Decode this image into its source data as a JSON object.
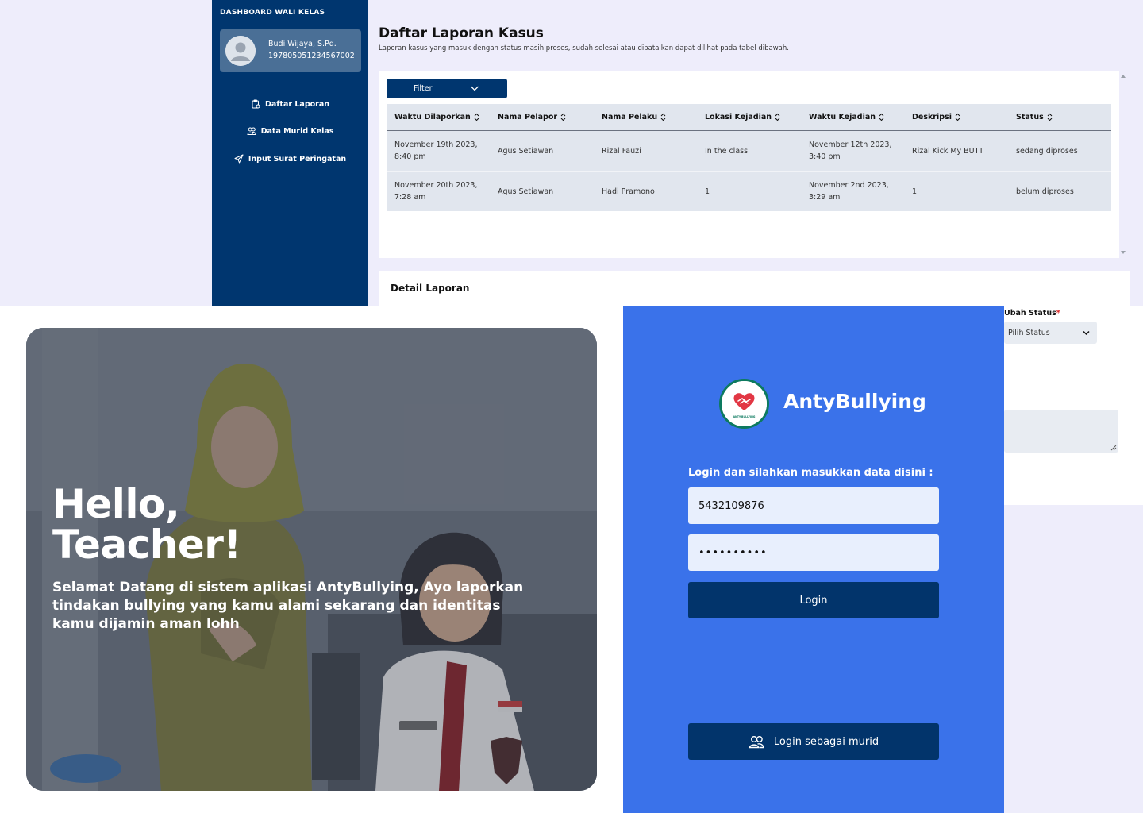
{
  "sidebar": {
    "title": "DASHBOARD WALI KELAS",
    "profile": {
      "name": "Budi Wijaya, S.Pd.",
      "nip": "197805051234567002"
    },
    "items": [
      {
        "label": "Daftar Laporan",
        "icon": "clipboard-icon"
      },
      {
        "label": "Data Murid Kelas",
        "icon": "users-icon"
      },
      {
        "label": "Input Surat Peringatan",
        "icon": "send-icon"
      }
    ]
  },
  "main": {
    "title": "Daftar Laporan Kasus",
    "subtitle": "Laporan kasus yang masuk dengan status masih proses, sudah selesai atau dibatalkan dapat dilihat pada tabel dibawah.",
    "filter_label": "Filter",
    "table": {
      "headers": [
        "Waktu Dilaporkan",
        "Nama Pelapor",
        "Nama Pelaku",
        "Lokasi Kejadian",
        "Waktu Kejadian",
        "Deskripsi",
        "Status"
      ],
      "rows": [
        {
          "reported_l1": "November 19th 2023,",
          "reported_l2": "8:40 pm",
          "reporter": "Agus Setiawan",
          "perpetrator": "Rizal Fauzi",
          "location": "In the class",
          "incident_l1": "November 12th 2023,",
          "incident_l2": "3:40 pm",
          "description": "Rizal Kick My BUTT",
          "status": "sedang diproses"
        },
        {
          "reported_l1": "November 20th 2023,",
          "reported_l2": "7:28 am",
          "reporter": "Agus Setiawan",
          "perpetrator": "Hadi Pramono",
          "location": "1",
          "incident_l1": "November 2nd 2023,",
          "incident_l2": "3:29 am",
          "description": "1",
          "status": "belum diproses"
        }
      ]
    },
    "detail": {
      "title": "Detail Laporan",
      "status_label": "Ubah Status",
      "required_mark": "*",
      "status_placeholder": "Pilih Status"
    }
  },
  "hero": {
    "title_line1": "Hello,",
    "title_line2": "Teacher!",
    "description": "Selamat Datang di sistem aplikasi AntyBullying, Ayo laporkan tindakan bullying yang kamu alami sekarang dan identitas kamu dijamin aman lohh"
  },
  "login": {
    "brand": "AntyBullying",
    "logo_text": "ANTY-BULLYING",
    "prompt": "Login dan silahkan masukkan data disini :",
    "username_value": "5432109876",
    "password_value": "••••••••••",
    "login_button": "Login",
    "student_button": "Login sebagai murid"
  },
  "colors": {
    "sidebar": "#00366f",
    "accent_blue": "#3a72ea",
    "button_navy": "#02346b",
    "lavender_bg": "#eeedfb",
    "table_bg": "#e1e6ee",
    "logo_green": "#0d7a5f",
    "logo_red": "#e23744"
  }
}
